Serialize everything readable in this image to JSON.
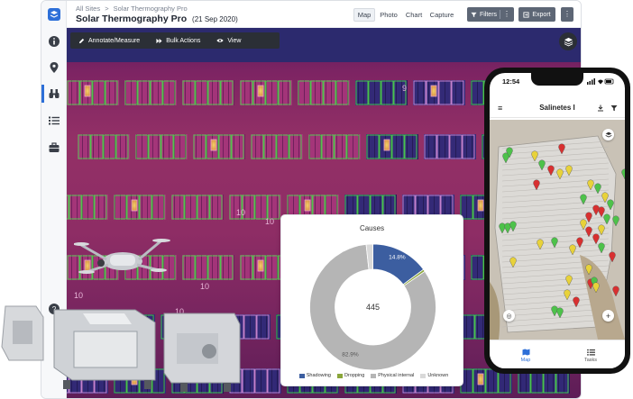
{
  "breadcrumb": {
    "root": "All Sites",
    "separator": ">",
    "current": "Solar Thermography Pro"
  },
  "page": {
    "title": "Solar Thermography Pro",
    "date": "(21 Sep 2020)"
  },
  "view_tabs": [
    "Map",
    "Photo",
    "Chart",
    "Capture"
  ],
  "active_view": "Map",
  "header_buttons": {
    "filters": "Filters",
    "export": "Export"
  },
  "sidebar_icons": [
    "info-icon",
    "location-pin-icon",
    "binoculars-icon",
    "list-icon",
    "briefcase-icon"
  ],
  "map_toolbar": {
    "annotate": "Annotate/Measure",
    "bulk": "Bulk Actions",
    "view": "View"
  },
  "map_labels": [
    "10",
    "9",
    "10",
    "10",
    "10",
    "10",
    "10",
    "10"
  ],
  "chart_data": {
    "type": "pie",
    "title": "Causes",
    "center_label": "445",
    "categories": [
      "Shadowing",
      "Dropping",
      "Physical internal",
      "Unknown"
    ],
    "values": [
      14.8,
      0.6,
      82.9,
      1.7
    ],
    "data_labels": [
      "14.8%",
      "",
      "82.9%",
      ""
    ],
    "colors": [
      "#3c5ea0",
      "#8aa63a",
      "#b5b5b5",
      "#d9d9d9"
    ],
    "legend_position": "bottom"
  },
  "phone": {
    "time": "12:54",
    "site_name": "Salinetes I",
    "tabs": [
      "Map",
      "Tasks"
    ]
  },
  "colors": {
    "accent": "#2d6fd8",
    "thermal_purple": "#7d2463",
    "panel_blue": "#3a2f8a",
    "flag_green": "#4dc24a",
    "flag_yellow": "#e8d23a",
    "flag_red": "#d83030"
  }
}
